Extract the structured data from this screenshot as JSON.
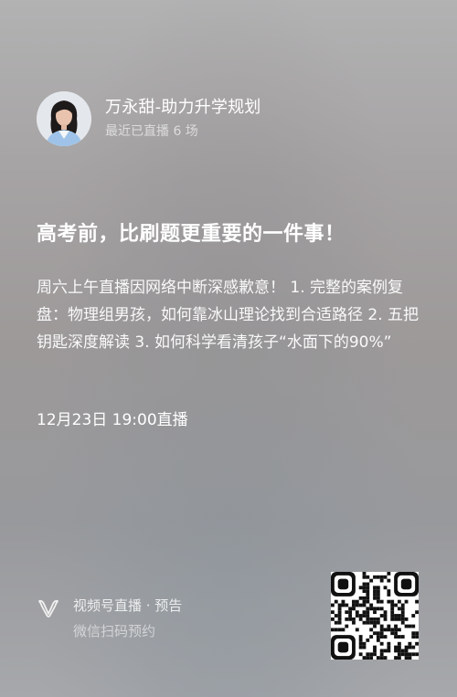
{
  "host": {
    "name": "万永甜-助力升学规划",
    "sub": "最近已直播 6 场"
  },
  "live": {
    "title": "高考前，比刷题更重要的一件事！",
    "description": "周六上午直播因网络中断深感歉意！ 1. 完整的案例复盘：物理组男孩，如何靠冰山理论找到合适路径 2. 五把钥匙深度解读 3. 如何科学看清孩子“水面下的90%”",
    "time": "12月23日 19:00直播"
  },
  "footer": {
    "brand": "视频号直播 · 预告",
    "scan_hint": "微信扫码预约"
  },
  "icons": {
    "avatar": "host-avatar-photo",
    "brand": "channels-icon",
    "qr": "qr-code"
  },
  "colors": {
    "text_primary": "#ffffff",
    "text_secondary": "#d8d8d8",
    "background": "#a3a1a2"
  }
}
